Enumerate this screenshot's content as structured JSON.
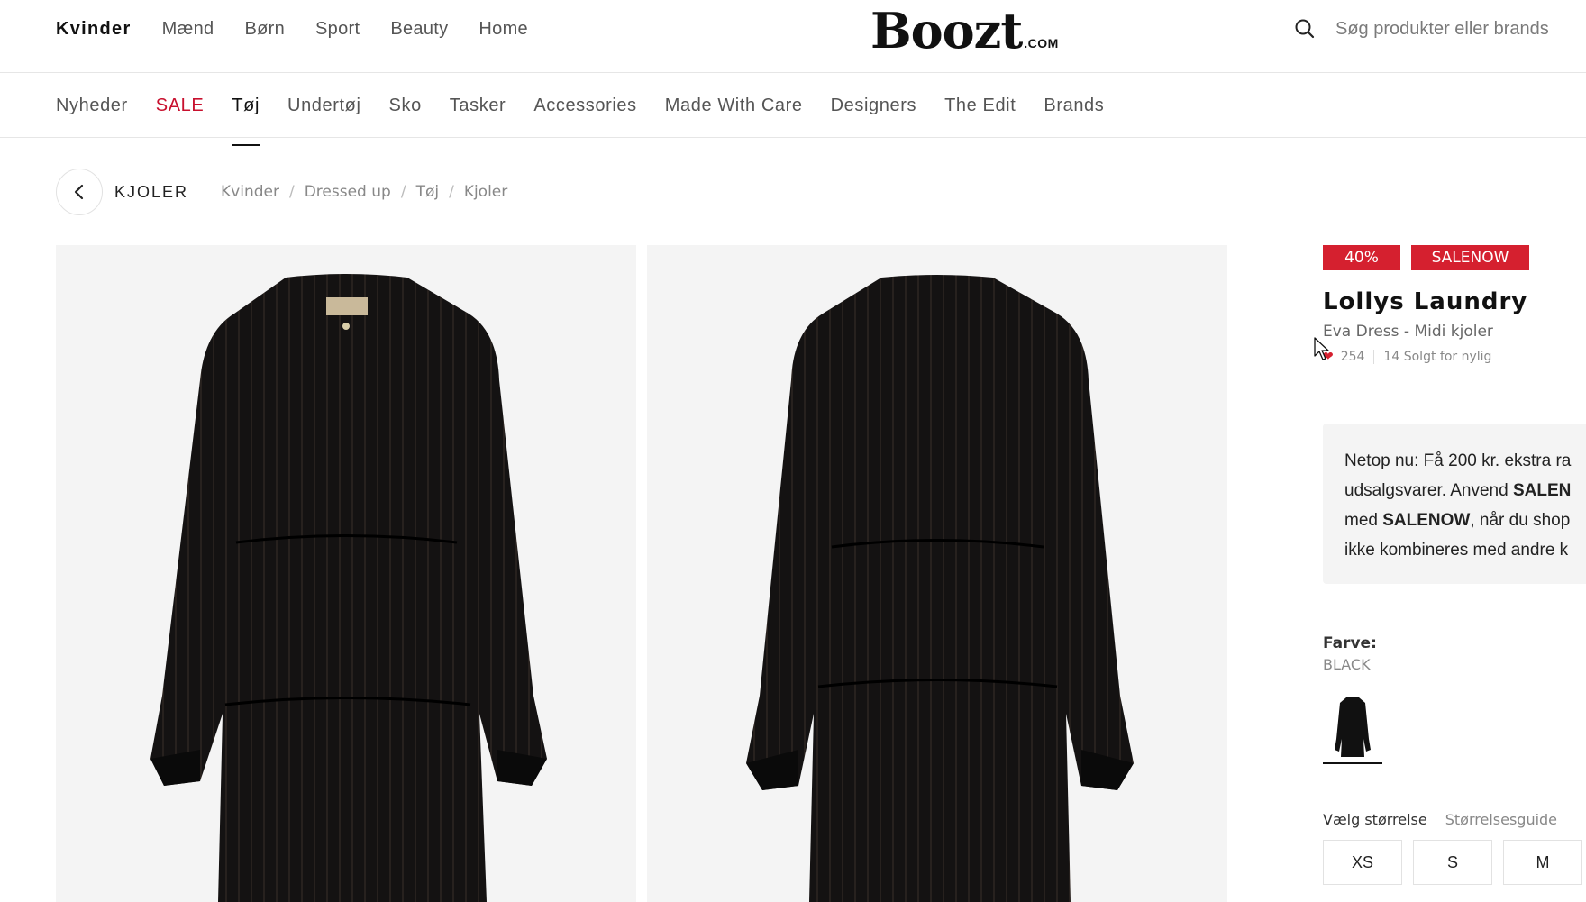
{
  "top_nav": {
    "items": [
      {
        "label": "Kvinder",
        "active": true
      },
      {
        "label": "Mænd",
        "active": false
      },
      {
        "label": "Børn",
        "active": false
      },
      {
        "label": "Sport",
        "active": false
      },
      {
        "label": "Beauty",
        "active": false
      },
      {
        "label": "Home",
        "active": false
      }
    ]
  },
  "logo": {
    "text": "Boozt",
    "suffix": ".COM"
  },
  "search": {
    "placeholder": "Søg produkter eller brands",
    "icon": "search-icon"
  },
  "category_nav": {
    "items": [
      {
        "label": "Nyheder"
      },
      {
        "label": "SALE"
      },
      {
        "label": "Tøj"
      },
      {
        "label": "Undertøj"
      },
      {
        "label": "Sko"
      },
      {
        "label": "Tasker"
      },
      {
        "label": "Accessories"
      },
      {
        "label": "Made With Care"
      },
      {
        "label": "Designers"
      },
      {
        "label": "The Edit"
      },
      {
        "label": "Brands"
      }
    ],
    "active": "Tøj",
    "sale_color": "#c8102e"
  },
  "breadcrumb": {
    "back_label": "KJOLER",
    "items": [
      "Kvinder",
      "Dressed up",
      "Tøj",
      "Kjoler"
    ]
  },
  "product": {
    "discount_badge": "40%",
    "code_badge": "SALENOW",
    "brand": "Lollys Laundry",
    "subtitle": "Eva Dress - Midi kjoler",
    "likes": "254",
    "sold": "14 Solgt for nylig",
    "promo": {
      "line1": "Netop nu: Få 200 kr. ekstra ra",
      "line2_pre": "udsalgsvarer. Anvend ",
      "line2_bold": "SALEN",
      "line3_pre": "med ",
      "line3_bold": "SALENOW",
      "line3_post": ", når du shop",
      "line4": "ikke kombineres med andre k"
    },
    "color_label": "Farve:",
    "color_value": "BLACK",
    "size_label": "Vælg størrelse",
    "size_guide": "Størrelsesguide",
    "sizes": [
      "XS",
      "S",
      "M"
    ]
  },
  "colors": {
    "accent": "#d5202f",
    "text": "#222222",
    "image_bg": "#f4f4f4"
  }
}
